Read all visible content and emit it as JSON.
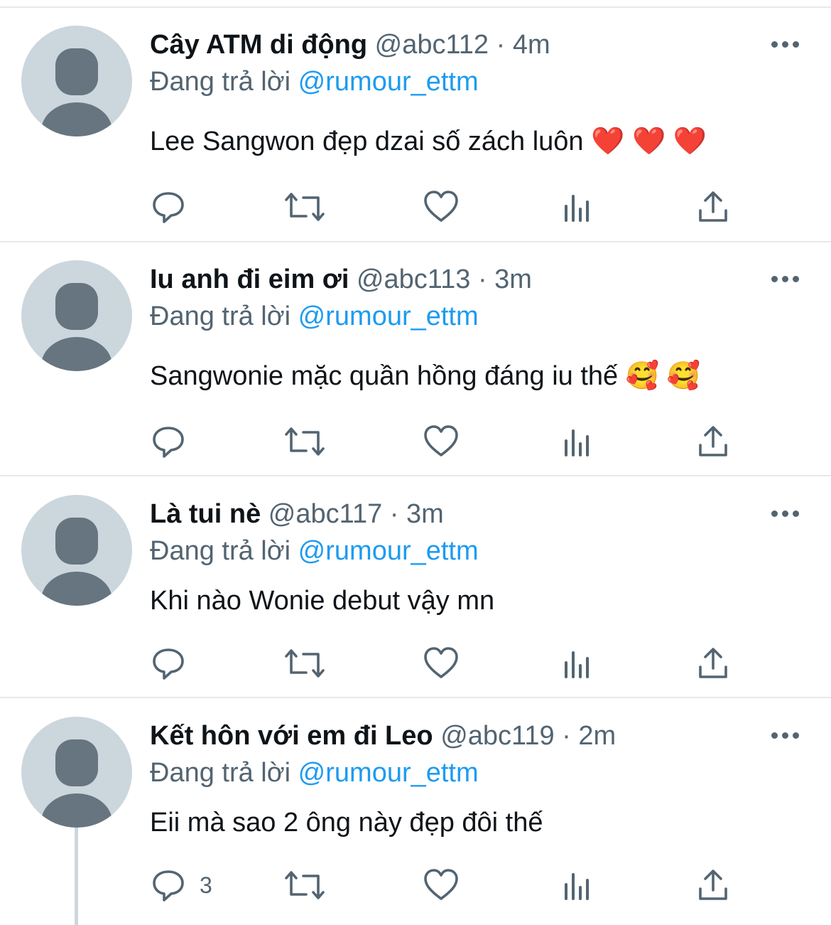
{
  "tweets": [
    {
      "name": "Cây ATM di động",
      "handle": "@abc112",
      "time": "4m",
      "reply_prefix": "Đang trả lời",
      "reply_to": "@rumour_ettm",
      "text": "Lee Sangwon đẹp dzai số zách luôn ❤️ ❤️ ❤️",
      "reply_count": ""
    },
    {
      "name": "Iu anh đi eim ơi",
      "handle": "@abc113",
      "time": "3m",
      "reply_prefix": "Đang trả lời",
      "reply_to": "@rumour_ettm",
      "text": "Sangwonie mặc quần hồng đáng iu thế 🥰 🥰",
      "reply_count": ""
    },
    {
      "name": "Là tui nè",
      "handle": "@abc117",
      "time": "3m",
      "reply_prefix": "Đang trả lời",
      "reply_to": "@rumour_ettm",
      "text": "Khi nào Wonie debut vậy mn",
      "reply_count": ""
    },
    {
      "name": "Kết hôn với em đi Leo",
      "handle": "@abc119",
      "time": "2m",
      "reply_prefix": "Đang trả lời",
      "reply_to": "@rumour_ettm",
      "text": "Eii mà sao 2 ông này đẹp đôi thế",
      "reply_count": "3"
    }
  ],
  "separator": " · ",
  "icons": {
    "avatar": "default-avatar-icon",
    "more": "more-icon",
    "reply": "reply-icon",
    "retweet": "retweet-icon",
    "like": "like-icon",
    "views": "views-icon",
    "share": "share-icon"
  },
  "colors": {
    "link": "#1d9bf0",
    "secondary_text": "#536471",
    "divider": "#e6e9ec",
    "avatar_bg": "#ccd6dd"
  }
}
